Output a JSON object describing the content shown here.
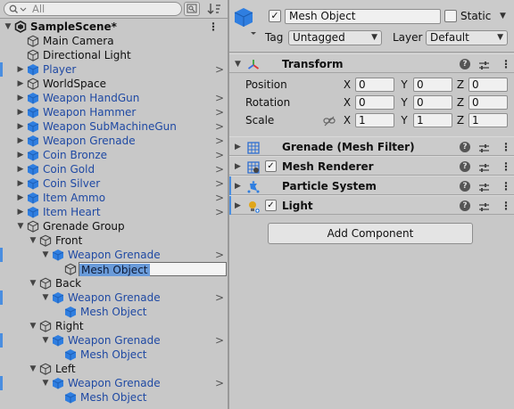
{
  "hierarchy": {
    "search_placeholder": "All",
    "scene_name": "SampleScene*",
    "rows": [
      {
        "label": "Main Camera",
        "prefab": false,
        "marker": false
      },
      {
        "label": "Directional Light",
        "prefab": false,
        "marker": false
      },
      {
        "label": "Player",
        "prefab": true,
        "marker": true
      },
      {
        "label": "WorldSpace",
        "prefab": false,
        "marker": false
      },
      {
        "label": "Weapon HandGun",
        "prefab": true,
        "marker": false
      },
      {
        "label": "Weapon Hammer",
        "prefab": true,
        "marker": false
      },
      {
        "label": "Weapon SubMachineGun",
        "prefab": true,
        "marker": false
      },
      {
        "label": "Weapon Grenade",
        "prefab": true,
        "marker": false
      },
      {
        "label": "Coin Bronze",
        "prefab": true,
        "marker": false
      },
      {
        "label": "Coin Gold",
        "prefab": true,
        "marker": false
      },
      {
        "label": "Coin Silver",
        "prefab": true,
        "marker": false
      },
      {
        "label": "Item Ammo",
        "prefab": true,
        "marker": false
      },
      {
        "label": "Item Heart",
        "prefab": true,
        "marker": false
      },
      {
        "label": "Grenade Group",
        "prefab": false,
        "marker": false
      },
      {
        "label": "Front",
        "prefab": false,
        "marker": false
      },
      {
        "label": "Weapon Grenade",
        "prefab": true,
        "marker": true
      },
      {
        "label": "Mesh Object",
        "prefab": false,
        "marker": false
      },
      {
        "label": "Back",
        "prefab": false,
        "marker": false
      },
      {
        "label": "Weapon Grenade",
        "prefab": true,
        "marker": true
      },
      {
        "label": "Mesh Object",
        "prefab": true,
        "marker": false
      },
      {
        "label": "Right",
        "prefab": false,
        "marker": false
      },
      {
        "label": "Weapon Grenade",
        "prefab": true,
        "marker": true
      },
      {
        "label": "Mesh Object",
        "prefab": true,
        "marker": false
      },
      {
        "label": "Left",
        "prefab": false,
        "marker": false
      },
      {
        "label": "Weapon Grenade",
        "prefab": true,
        "marker": true
      },
      {
        "label": "Mesh Object",
        "prefab": true,
        "marker": false
      }
    ]
  },
  "inspector": {
    "object_name": "Mesh Object",
    "static_label": "Static",
    "tag_label": "Tag",
    "tag_value": "Untagged",
    "layer_label": "Layer",
    "layer_value": "Default",
    "transform": {
      "title": "Transform",
      "position_label": "Position",
      "rotation_label": "Rotation",
      "scale_label": "Scale",
      "axis_x": "X",
      "axis_y": "Y",
      "axis_z": "Z",
      "position": [
        "0",
        "0",
        "0"
      ],
      "rotation": [
        "0",
        "0",
        "0"
      ],
      "scale": [
        "1",
        "1",
        "1"
      ]
    },
    "components": [
      {
        "name": "Grenade (Mesh Filter)"
      },
      {
        "name": "Mesh Renderer"
      },
      {
        "name": "Particle System"
      },
      {
        "name": "Light"
      }
    ],
    "add_component_label": "Add Component"
  },
  "colors": {
    "prefab_text": "#1f49a3",
    "prefab_icon": "#2f7ee0",
    "override_marker": "#4a8ee0",
    "panel_bg": "#c8c8c8"
  },
  "icons": {
    "scene": "unity-scene-icon",
    "gameobject": "gameobject-cube-icon",
    "prefab": "prefab-cube-icon"
  }
}
